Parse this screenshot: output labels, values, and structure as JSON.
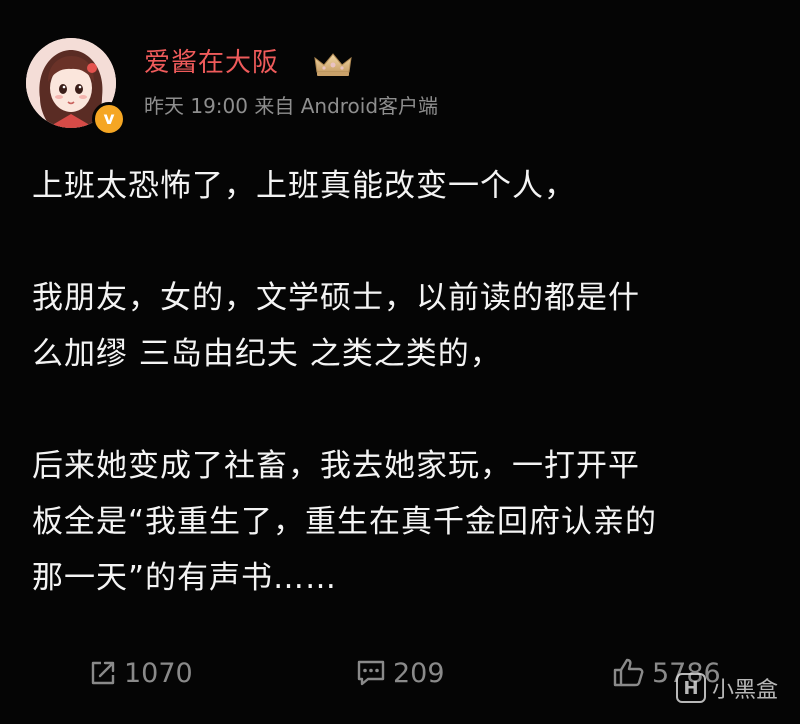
{
  "post": {
    "author": {
      "name": "爱酱在大阪",
      "badge_icon": "crown-icon",
      "verified_icon": "verified-v-icon",
      "verified_label": "v"
    },
    "meta": {
      "time": "昨天 19:00",
      "source": "来自 Android客户端"
    },
    "content": {
      "paragraphs": [
        "上班太恐怖了，上班真能改变一个人，",
        "我朋友，女的，文学硕士，以前读的都是什\n么加缪 三岛由纪夫 之类之类的，",
        "后来她变成了社畜，我去她家玩，一打开平\n板全是“我重生了，重生在真千金回府认亲的\n那一天”的有声书……"
      ]
    },
    "actions": {
      "share": {
        "icon": "share-icon",
        "count": "1070"
      },
      "comment": {
        "icon": "comment-icon",
        "count": "209"
      },
      "like": {
        "icon": "thumbs-up-icon",
        "count": "5786"
      }
    }
  },
  "watermark": {
    "icon": "xiaoheihe-logo-icon",
    "text": "小黑盒"
  },
  "colors": {
    "background": "#050505",
    "username": "#ef5b5b",
    "meta": "#8e8e8e",
    "body_text": "#f4f4f4",
    "action": "#8a8a8a",
    "verified_badge": "#f5a623"
  }
}
